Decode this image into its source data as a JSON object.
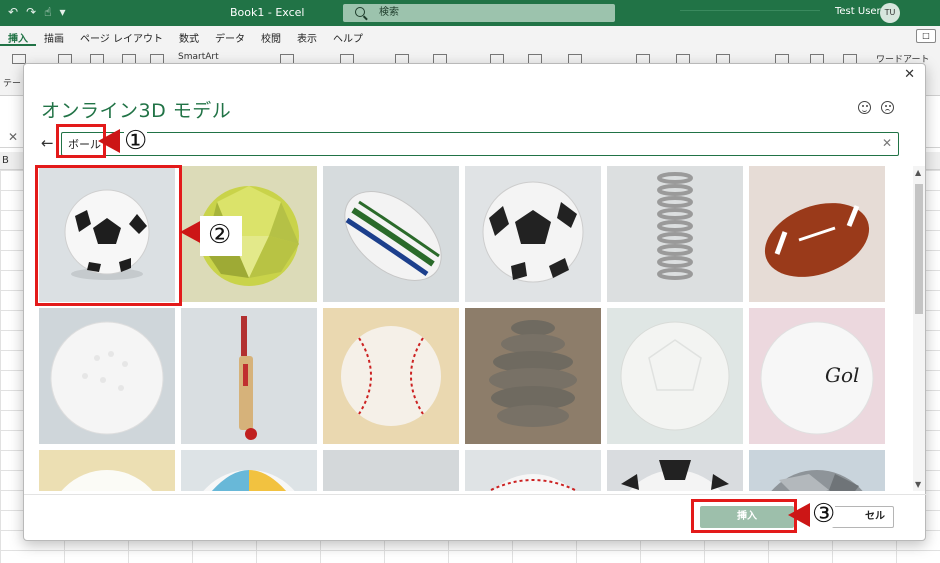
{
  "app": {
    "doc_title": "Book1 - Excel",
    "search_placeholder": "検索",
    "user_name": "Test User",
    "user_initials": "TU"
  },
  "ribbon": {
    "tabs": [
      "挿入",
      "描画",
      "ページ レイアウト",
      "数式",
      "データ",
      "校閲",
      "表示",
      "ヘルプ"
    ],
    "active_tab": "挿入",
    "smartart_label": "SmartArt",
    "wordart_label": "ワードアート",
    "side_label": "テー\nル"
  },
  "grid": {
    "column_label": "B"
  },
  "dialog": {
    "title": "オンライン3D モデル",
    "search_value": "ボール",
    "insert_label": "挿入",
    "cancel_label": "セル",
    "close_icon": "close-icon",
    "models": [
      "soccer-ball",
      "geodesic-ball",
      "rugby-ball",
      "soccer-ball-2",
      "spring",
      "american-football",
      "golf-ball",
      "cricket-bat-and-ball",
      "baseball",
      "stacked-rings",
      "ball-plain",
      "golf-ball-2",
      "ball-yellow",
      "beach-ball",
      "ball-gray",
      "baseball-2",
      "soccer-ball-3",
      "ball-metal"
    ]
  },
  "annotations": {
    "step1": "①",
    "step2": "②",
    "step3": "③"
  },
  "colors": {
    "excel_green": "#217346",
    "annotation_red": "#e31a1a"
  }
}
